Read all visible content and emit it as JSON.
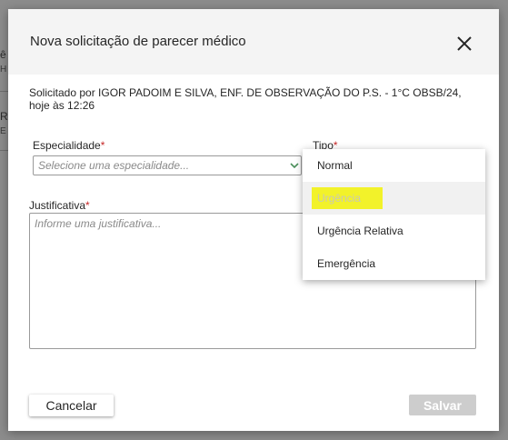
{
  "background": {
    "fragments": [
      "ê",
      "H",
      "R",
      "E"
    ]
  },
  "modal": {
    "title": "Nova solicitação de parecer médico",
    "close_icon": "close-icon",
    "requested_by": "Solicitado por IGOR PADOIM E SILVA, ENF. DE OBSERVAÇÃO DO P.S. - 1°C OBSB/24, hoje às 12:26",
    "specialty": {
      "label": "Especialidade",
      "required_mark": "*",
      "placeholder": "Selecione uma especialidade..."
    },
    "type": {
      "label": "Tipo",
      "required_mark": "*",
      "options": [
        "Normal",
        "Urgência",
        "Urgência Relativa",
        "Emergência"
      ],
      "hovered_option": "Urgência"
    },
    "justification": {
      "label": "Justificativa",
      "required_mark": "*",
      "placeholder": "Informe uma justificativa..."
    },
    "buttons": {
      "cancel": "Cancelar",
      "save": "Salvar"
    }
  },
  "colors": {
    "required": "#c62828",
    "highlight": "#f2f22a",
    "save_disabled": "#cdcdcd"
  }
}
